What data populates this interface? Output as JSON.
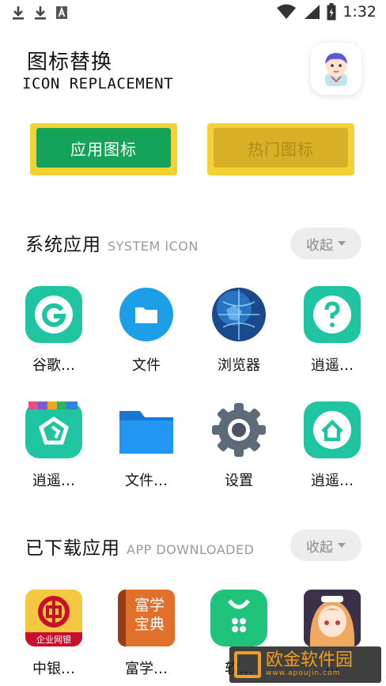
{
  "status_bar": {
    "time": "1:32"
  },
  "header": {
    "title_cn": "图标替换",
    "title_en": "ICON REPLACEMENT"
  },
  "tabs": {
    "apps_label": "应用图标",
    "hot_label": "热门图标"
  },
  "system_section": {
    "title": "系统应用",
    "subtitle": "SYSTEM ICON",
    "collapse_label": "收起",
    "apps": [
      {
        "label": "谷歌…",
        "icon": "google-icon"
      },
      {
        "label": "文件",
        "icon": "folder-icon"
      },
      {
        "label": "浏览器",
        "icon": "globe-icon"
      },
      {
        "label": "逍遥…",
        "icon": "help-icon"
      },
      {
        "label": "逍遥…",
        "icon": "store-icon"
      },
      {
        "label": "文件…",
        "icon": "folder-blue-icon"
      },
      {
        "label": "设置",
        "icon": "gear-icon"
      },
      {
        "label": "逍遥…",
        "icon": "home-icon"
      }
    ]
  },
  "downloaded_section": {
    "title": "已下载应用",
    "subtitle": "APP DOWNLOADED",
    "collapse_label": "收起",
    "apps": [
      {
        "label": "中银…",
        "icon": "bank-icon",
        "icon_text": "企业网银"
      },
      {
        "label": "富学…",
        "icon": "book-icon",
        "icon_text": "富学宝典"
      },
      {
        "label": "软…",
        "icon": "shopping-bag-icon"
      },
      {
        "label": "…",
        "icon": "anime-girl-icon"
      }
    ]
  },
  "watermark": {
    "text": "欧金软件园",
    "sub": "www.apoujin.com"
  },
  "colors": {
    "accent_green": "#15a35a",
    "accent_yellow": "#f2d235",
    "teal": "#1fc4a0"
  }
}
